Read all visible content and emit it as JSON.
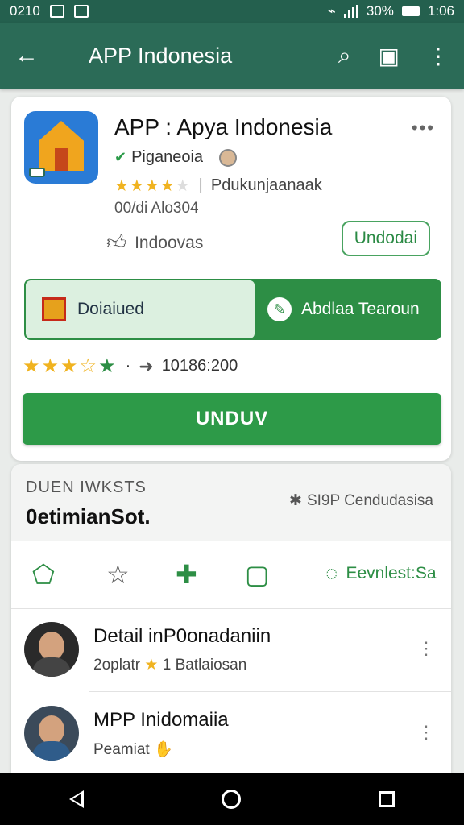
{
  "status_bar": {
    "time_left": "0210",
    "battery": "30%",
    "time_right": "1:06"
  },
  "appbar": {
    "title": "APP Indonesia",
    "back_icon": "arrow-left-icon",
    "search_icon": "search-icon",
    "profile_icon": "badge-icon",
    "more_icon": "more-vert-icon"
  },
  "app_card": {
    "name": "APP : Apya Indonesia",
    "developer": "Piganeoia",
    "rating_stars": 4,
    "rating_text": "Pdukunjaanaak",
    "info": "00/di Alo304",
    "like_text": "Indoovas",
    "outline_button": "Undodai",
    "segment_left": "Doiaiued",
    "segment_right": "Abdlaa Tearoun",
    "stats_stars": 3.5,
    "stats_count": "10186:200",
    "main_button": "UNDUV"
  },
  "section": {
    "overline": "DUEN IWKSTS",
    "title": "0etimianSot.",
    "right_label": "SI9P Cendudasisa",
    "tabs": {
      "home_icon": "home-icon",
      "star_icon": "star-icon",
      "pin_icon": "pin-icon",
      "folder_icon": "folder-icon",
      "chat_label": "Eevnlest:Sa"
    }
  },
  "list": [
    {
      "title": "Detail inP0onadaniin",
      "subtitle_prefix": "2oplatr",
      "subtitle_suffix": "1 Batlaiosan"
    },
    {
      "title": "MPP Inidomaiia",
      "subtitle_prefix": "Peamiat",
      "subtitle_suffix": ""
    }
  ],
  "colors": {
    "primary": "#2b6b57",
    "accent": "#2d9a48",
    "star": "#f0b320"
  }
}
